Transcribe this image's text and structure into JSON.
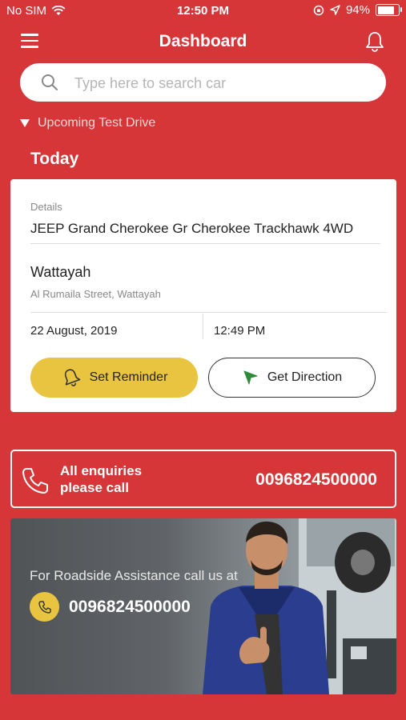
{
  "status_bar": {
    "carrier": "No SIM",
    "time": "12:50 PM",
    "battery": "94%",
    "battery_level": 0.94
  },
  "header": {
    "title": "Dashboard",
    "menu_icon": "hamburger-menu-icon",
    "bell_icon": "bell-icon"
  },
  "search": {
    "placeholder": "Type here to search car",
    "value": ""
  },
  "upcoming": {
    "label": "Upcoming Test Drive"
  },
  "day_label": "Today",
  "test_drive": {
    "details_label": "Details",
    "car": "JEEP Grand Cherokee Gr Cherokee Trackhawk 4WD",
    "location": "Wattayah",
    "address": "Al Rumaila Street, Wattayah",
    "date": "22 August, 2019",
    "time": "12:49 PM",
    "reminder_label": "Set Reminder",
    "direction_label": "Get Direction"
  },
  "enquiry": {
    "text_line1": "All enquiries",
    "text_line2": "please call",
    "phone": "0096824500000"
  },
  "roadside": {
    "text": "For Roadside Assistance call us at",
    "phone": "0096824500000"
  },
  "colors": {
    "primary_red": "#D63638",
    "accent_yellow": "#E9C441",
    "direction_green": "#2E8B3A"
  }
}
